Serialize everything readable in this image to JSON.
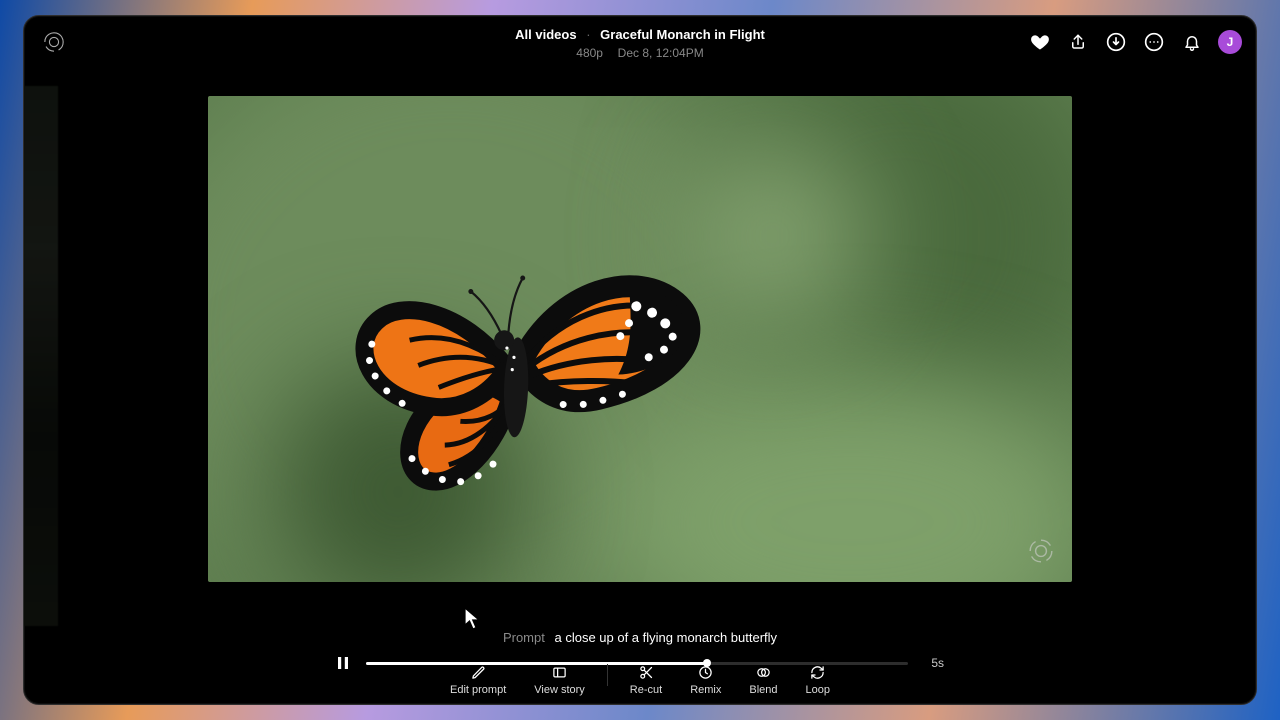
{
  "header": {
    "breadcrumb_root": "All videos",
    "title": "Graceful Monarch in Flight",
    "resolution": "480p",
    "timestamp": "Dec 8, 12:04PM",
    "avatar_initial": "J"
  },
  "prompt": {
    "label": "Prompt",
    "text": "a close up of a flying monarch butterfly"
  },
  "player": {
    "state": "playing",
    "duration_label": "5s",
    "progress_percent": 63
  },
  "tools": [
    {
      "id": "edit-prompt",
      "label": "Edit prompt"
    },
    {
      "id": "view-story",
      "label": "View story"
    },
    {
      "id": "re-cut",
      "label": "Re-cut"
    },
    {
      "id": "remix",
      "label": "Remix"
    },
    {
      "id": "blend",
      "label": "Blend"
    },
    {
      "id": "loop",
      "label": "Loop"
    }
  ],
  "icons": {
    "heart": "heart-icon",
    "share": "share-icon",
    "download": "download-icon",
    "more": "more-icon",
    "bell": "bell-icon"
  }
}
